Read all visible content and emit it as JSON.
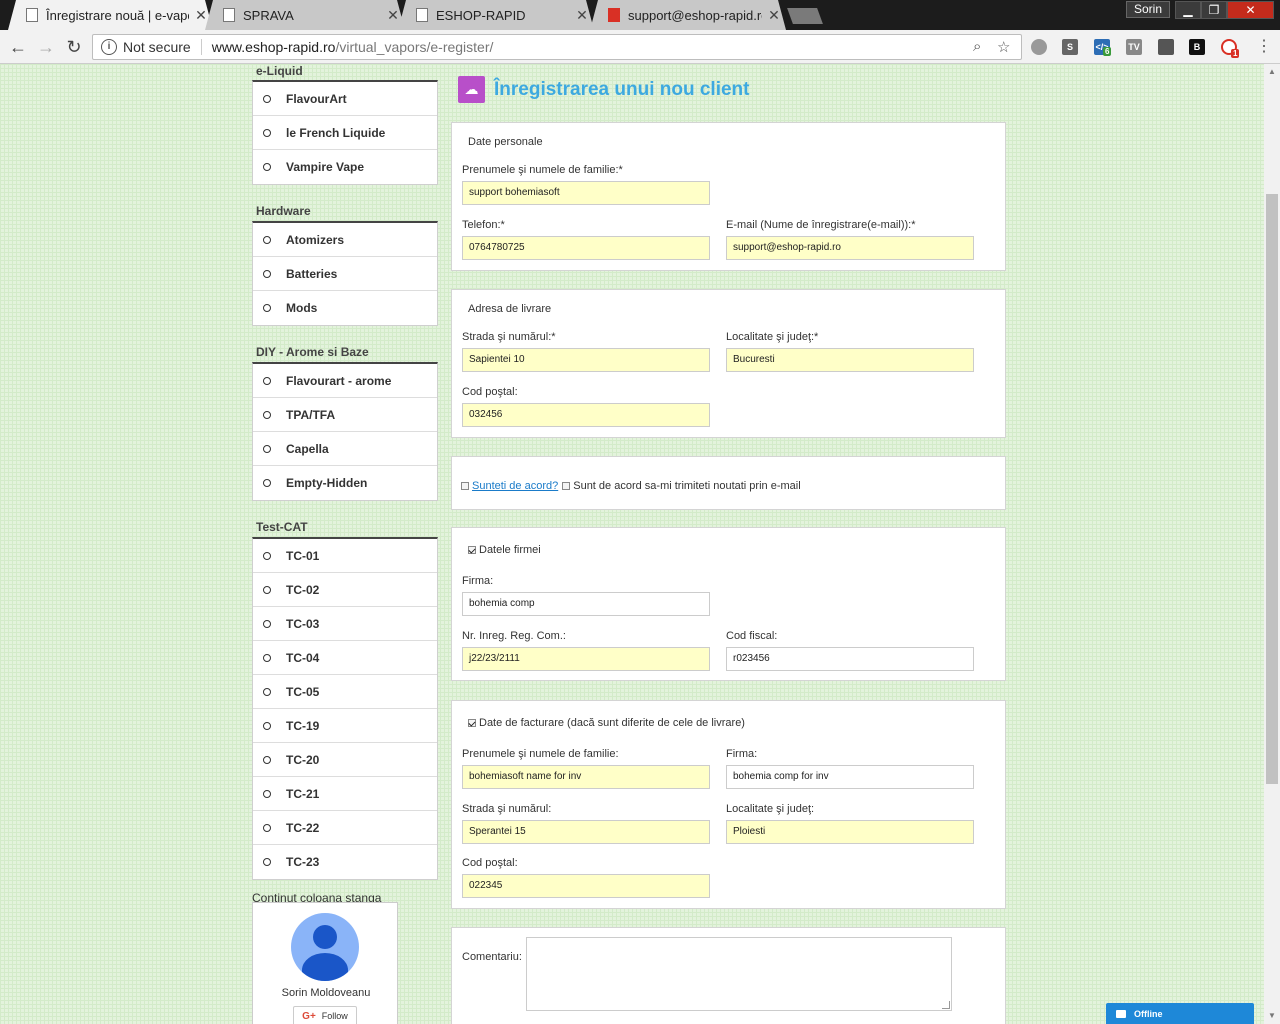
{
  "browser": {
    "tabs": [
      {
        "title": "Înregistrare nouă | e-vapo"
      },
      {
        "title": "SPRAVA"
      },
      {
        "title": "ESHOP-RAPID"
      },
      {
        "title": "support@eshop-rapid.ro"
      }
    ],
    "profile": "Sorin",
    "security": "Not secure",
    "url_host": "www.eshop-rapid.ro",
    "url_path": "/virtual_vapors/e-register/",
    "ext_badges": [
      "6",
      "1"
    ]
  },
  "sidebar": {
    "categories": [
      {
        "title": "e-Liquid",
        "items": [
          "FlavourArt",
          "le French Liquide",
          "Vampire Vape"
        ]
      },
      {
        "title": "Hardware",
        "items": [
          "Atomizers",
          "Batteries",
          "Mods"
        ]
      },
      {
        "title": "DIY - Arome si Baze",
        "items": [
          "Flavourart - arome",
          "TPA/TFA",
          "Capella",
          "Empty-Hidden"
        ]
      },
      {
        "title": "Test-CAT",
        "items": [
          "TC-01",
          "TC-02",
          "TC-03",
          "TC-04",
          "TC-05",
          "TC-19",
          "TC-20",
          "TC-21",
          "TC-22",
          "TC-23"
        ]
      }
    ],
    "continuation_label": "Continut coloana stanga",
    "gplus": {
      "name": "Sorin Moldoveanu",
      "follow_label": "Follow",
      "g_label": "G+"
    }
  },
  "form": {
    "title": "Înregistrarea unui nou client",
    "personal": {
      "legend": "Date personale",
      "name_label": "Prenumele şi numele de familie:*",
      "name_value": "support bohemiasoft",
      "phone_label": "Telefon:*",
      "phone_value": "0764780725",
      "email_label": "E-mail (Nume de înregistrare(e-mail)):*",
      "email_value": "support@eshop-rapid.ro"
    },
    "delivery": {
      "legend": "Adresa de livrare",
      "street_label": "Strada şi numărul:*",
      "street_value": "Sapientei 10",
      "city_label": "Localitate şi judeţ:*",
      "city_value": "Bucuresti",
      "zip_label": "Cod poştal:",
      "zip_value": "032456"
    },
    "agreement": {
      "terms_link": "Sunteti de acord?",
      "newsletter_label": "Sunt de acord sa-mi trimiteti noutati prin e-mail"
    },
    "company": {
      "legend": "Datele firmei",
      "firm_label": "Firma:",
      "firm_value": "bohemia comp",
      "reg_label": "Nr. Inreg. Reg. Com.:",
      "reg_value": "j22/23/2111",
      "tax_label": "Cod fiscal:",
      "tax_value": "r023456"
    },
    "billing": {
      "legend": "Date de facturare (dacă sunt diferite de cele de livrare)",
      "name_label": "Prenumele şi numele de familie:",
      "name_value": "bohemiasoft name for inv",
      "firm_label": "Firma:",
      "firm_value": "bohemia comp for inv",
      "street_label": "Strada şi numărul:",
      "street_value": "Sperantei 15",
      "city_label": "Localitate şi judeţ:",
      "city_value": "Ploiesti",
      "zip_label": "Cod poştal:",
      "zip_value": "022345"
    },
    "comment": {
      "label": "Comentariu:"
    }
  },
  "chat": {
    "label": "Offline"
  },
  "icons": {
    "back": "back-arrow-icon",
    "forward": "forward-arrow-icon",
    "reload": "reload-icon",
    "info": "info-icon",
    "zoom": "search-icon",
    "star": "star-icon",
    "title_icon": "add-user-icon",
    "bullet": "circle-bullet-icon",
    "chat": "envelope-icon"
  },
  "colors": {
    "accent": "#3da9e0",
    "title_icon_bg": "#b84fc9",
    "input_highlight": "#ffffc8",
    "page_bg": "#e3f3dc",
    "link": "#1a7bc9",
    "chat_bg": "#1e88d8"
  }
}
